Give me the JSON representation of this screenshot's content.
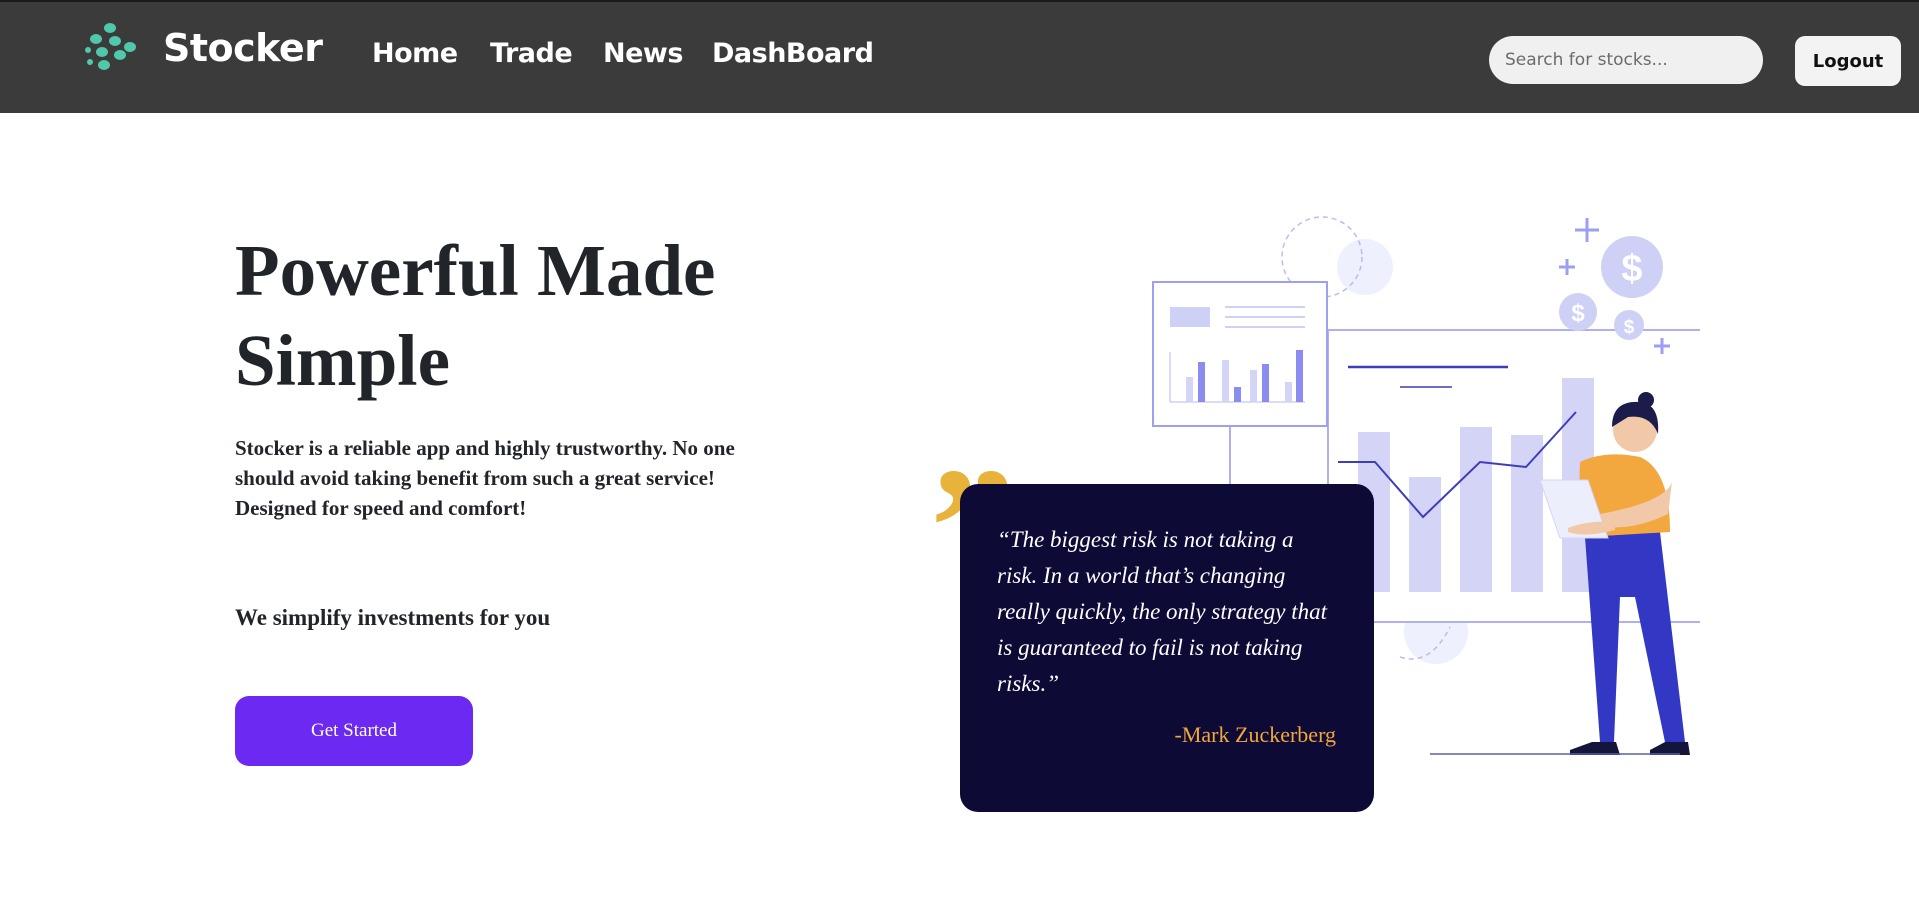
{
  "nav": {
    "brand": "Stocker",
    "links": [
      "Home",
      "Trade",
      "News",
      "DashBoard"
    ],
    "search_placeholder": "Search for stocks...",
    "logout_label": "Logout"
  },
  "hero": {
    "title": "Powerful Made Simple",
    "description": "Stocker is a reliable app and highly trustworthy. No one should avoid taking benefit from such a great service! Designed for speed and comfort!",
    "tagline": "We simplify investments for you",
    "cta_label": "Get Started"
  },
  "quote": {
    "mark": "”",
    "text": "“The biggest risk is not taking a risk. In a world that’s changing really quickly, the only strategy that is guaranteed to fail is not taking risks.”",
    "author": "-Mark Zuckerberg"
  },
  "colors": {
    "navbar": "#3b3b3b",
    "accent": "#6b29f2",
    "logo": "#4fc9a9",
    "quote_card": "#0d0a36",
    "quote_author": "#f1a73c",
    "quote_mark": "#e8b33a",
    "chart_bar": "#d4d4f7",
    "figure_pants": "#3338c4",
    "figure_shirt": "#f3a73f"
  },
  "icons": {
    "logo": "dots-logo-icon",
    "illustration": "person-with-laptop-chart-illustration",
    "dollar": "dollar-coin-icon",
    "plus": "plus-icon"
  }
}
